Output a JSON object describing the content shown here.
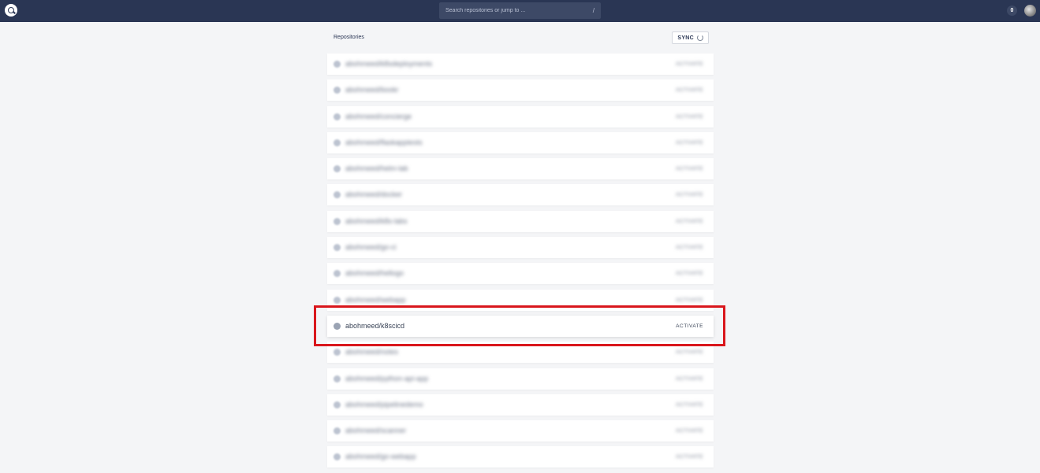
{
  "topbar": {
    "search_placeholder": "Search repositories or jump to ...",
    "search_shortcut": "/",
    "notification_count": "0"
  },
  "main": {
    "title": "Repositories",
    "sync_label": "SYNC"
  },
  "repos": [
    {
      "name": "abohmeed/k8sdeployments",
      "action": "ACTIVATE",
      "blurred": true
    },
    {
      "name": "abohmeed/bookr",
      "action": "ACTIVATE",
      "blurred": true
    },
    {
      "name": "abohmeed/concierge",
      "action": "ACTIVATE",
      "blurred": true
    },
    {
      "name": "abohmeed/flaskapptests",
      "action": "ACTIVATE",
      "blurred": true
    },
    {
      "name": "abohmeed/helm-lab",
      "action": "ACTIVATE",
      "blurred": true
    },
    {
      "name": "abohmeed/docker",
      "action": "ACTIVATE",
      "blurred": true
    },
    {
      "name": "abohmeed/k8s-labs",
      "action": "ACTIVATE",
      "blurred": true
    },
    {
      "name": "abohmeed/go-ci",
      "action": "ACTIVATE",
      "blurred": true
    },
    {
      "name": "abohmeed/hellogo",
      "action": "ACTIVATE",
      "blurred": true
    },
    {
      "name": "abohmeed/webapp",
      "action": "ACTIVATE",
      "blurred": true
    },
    {
      "name": "abohmeed/k8scicd",
      "action": "ACTIVATE",
      "blurred": false,
      "highlighted": true
    },
    {
      "name": "abohmeed/notes",
      "action": "ACTIVATE",
      "blurred": true
    },
    {
      "name": "abohmeed/python-api-app",
      "action": "ACTIVATE",
      "blurred": true
    },
    {
      "name": "abohmeed/pipelinedemo",
      "action": "ACTIVATE",
      "blurred": true
    },
    {
      "name": "abohmeed/scanner",
      "action": "ACTIVATE",
      "blurred": true
    },
    {
      "name": "abohmeed/go-webapp",
      "action": "ACTIVATE",
      "blurred": true
    }
  ],
  "colors": {
    "topbar": "#2a3654",
    "highlight_box": "#d9161c",
    "background": "#f4f5f7"
  }
}
